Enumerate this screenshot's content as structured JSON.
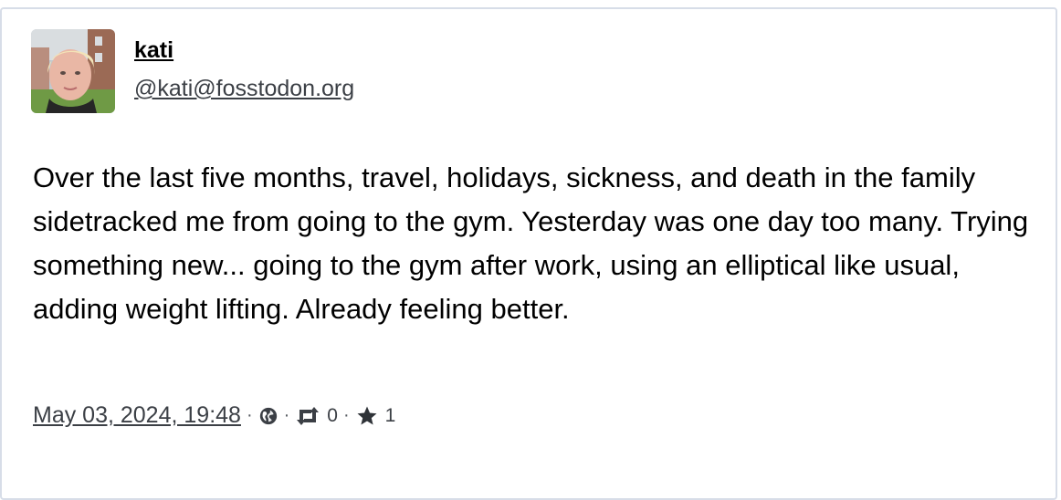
{
  "post": {
    "author": {
      "display_name": "kati",
      "handle": "@kati@fosstodon.org"
    },
    "content": "Over the last five months, travel, holidays, sickness, and death in the family sidetracked me from going to the gym. Yesterday was one day too many. Trying something new... going to the gym after work, using an elliptical like usual, adding weight lifting. Already feeling better.",
    "timestamp": "May 03, 2024, 19:48",
    "visibility_icon": "globe-icon",
    "boost_icon": "boost-icon",
    "boost_count": "0",
    "favourite_icon": "star-icon",
    "favourite_count": "1",
    "separator": "·"
  },
  "colors": {
    "border": "#d7dde8",
    "text": "#000000",
    "muted": "#3b3f45"
  }
}
